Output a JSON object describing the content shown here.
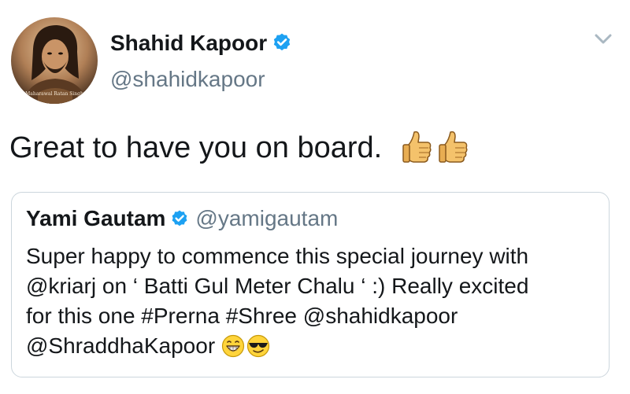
{
  "tweet": {
    "author": {
      "name": "Shahid Kapoor",
      "handle": "@shahidkapoor",
      "verified": true,
      "avatar_caption": "Maharawal Ratan Singh"
    },
    "text": "Great to have you on board.",
    "emojis": [
      "thumbs-up-icon",
      "thumbs-up-icon"
    ],
    "menu_icon": "chevron-down-icon"
  },
  "quoted_tweet": {
    "author": {
      "name": "Yami Gautam",
      "handle": "@yamigautam",
      "verified": true
    },
    "lines": [
      "Super happy to commence this special journey with",
      "@kriarj on ‘ Batti Gul Meter Chalu ‘ :) Really excited",
      "for this one #Prerna #Shree @shahidkapoor",
      "@ShraddhaKapoor"
    ],
    "emojis": [
      "grinning-face-icon",
      "sunglasses-face-icon"
    ]
  },
  "colors": {
    "text": "#14171a",
    "secondary": "#657786",
    "verified": "#1da1f2",
    "border": "#ccd6dd"
  }
}
